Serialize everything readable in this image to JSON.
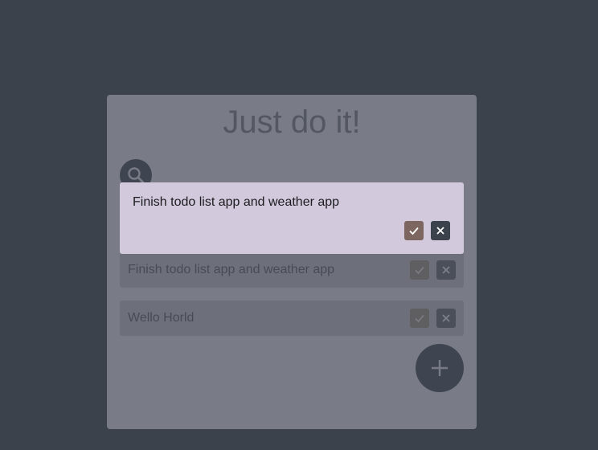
{
  "app": {
    "title": "Just do it!"
  },
  "todos": [
    {
      "text": "Finish todo list app and weather app"
    },
    {
      "text": "Wello Horld"
    }
  ],
  "edit_modal": {
    "value": "Finish todo list app and weather app"
  },
  "icons": {
    "search": "search-icon",
    "check": "check-icon",
    "close": "close-icon",
    "add": "plus-icon"
  },
  "colors": {
    "background": "#3b424c",
    "card": "#797c86",
    "modal": "#d2c9dc",
    "confirm": "#7d6660",
    "dark": "#3f4550"
  }
}
